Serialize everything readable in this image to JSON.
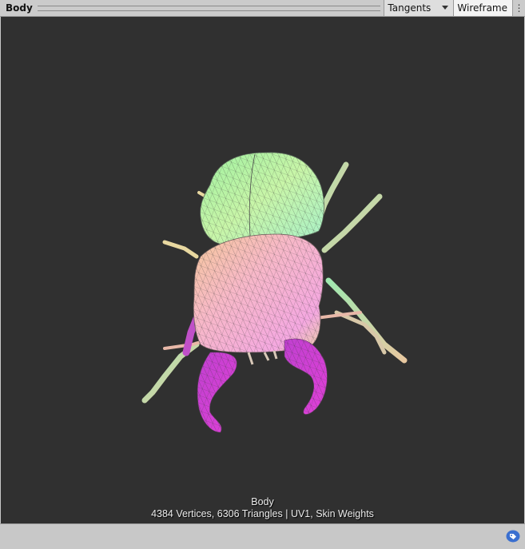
{
  "header": {
    "title": "Body",
    "dropdown_value": "Tangents",
    "toggle_label": "Wireframe",
    "menu_glyph": "⋮"
  },
  "preview": {
    "mesh_name": "Body",
    "stats": "4384 Vertices, 6306 Triangles | UV1, Skin Weights"
  },
  "status": {
    "icon": "label-tag-icon"
  },
  "colors": {
    "viewport_bg": "#303030",
    "toolbar_bg": "#cbcbcb",
    "accent_blue": "#3a6fd0"
  }
}
